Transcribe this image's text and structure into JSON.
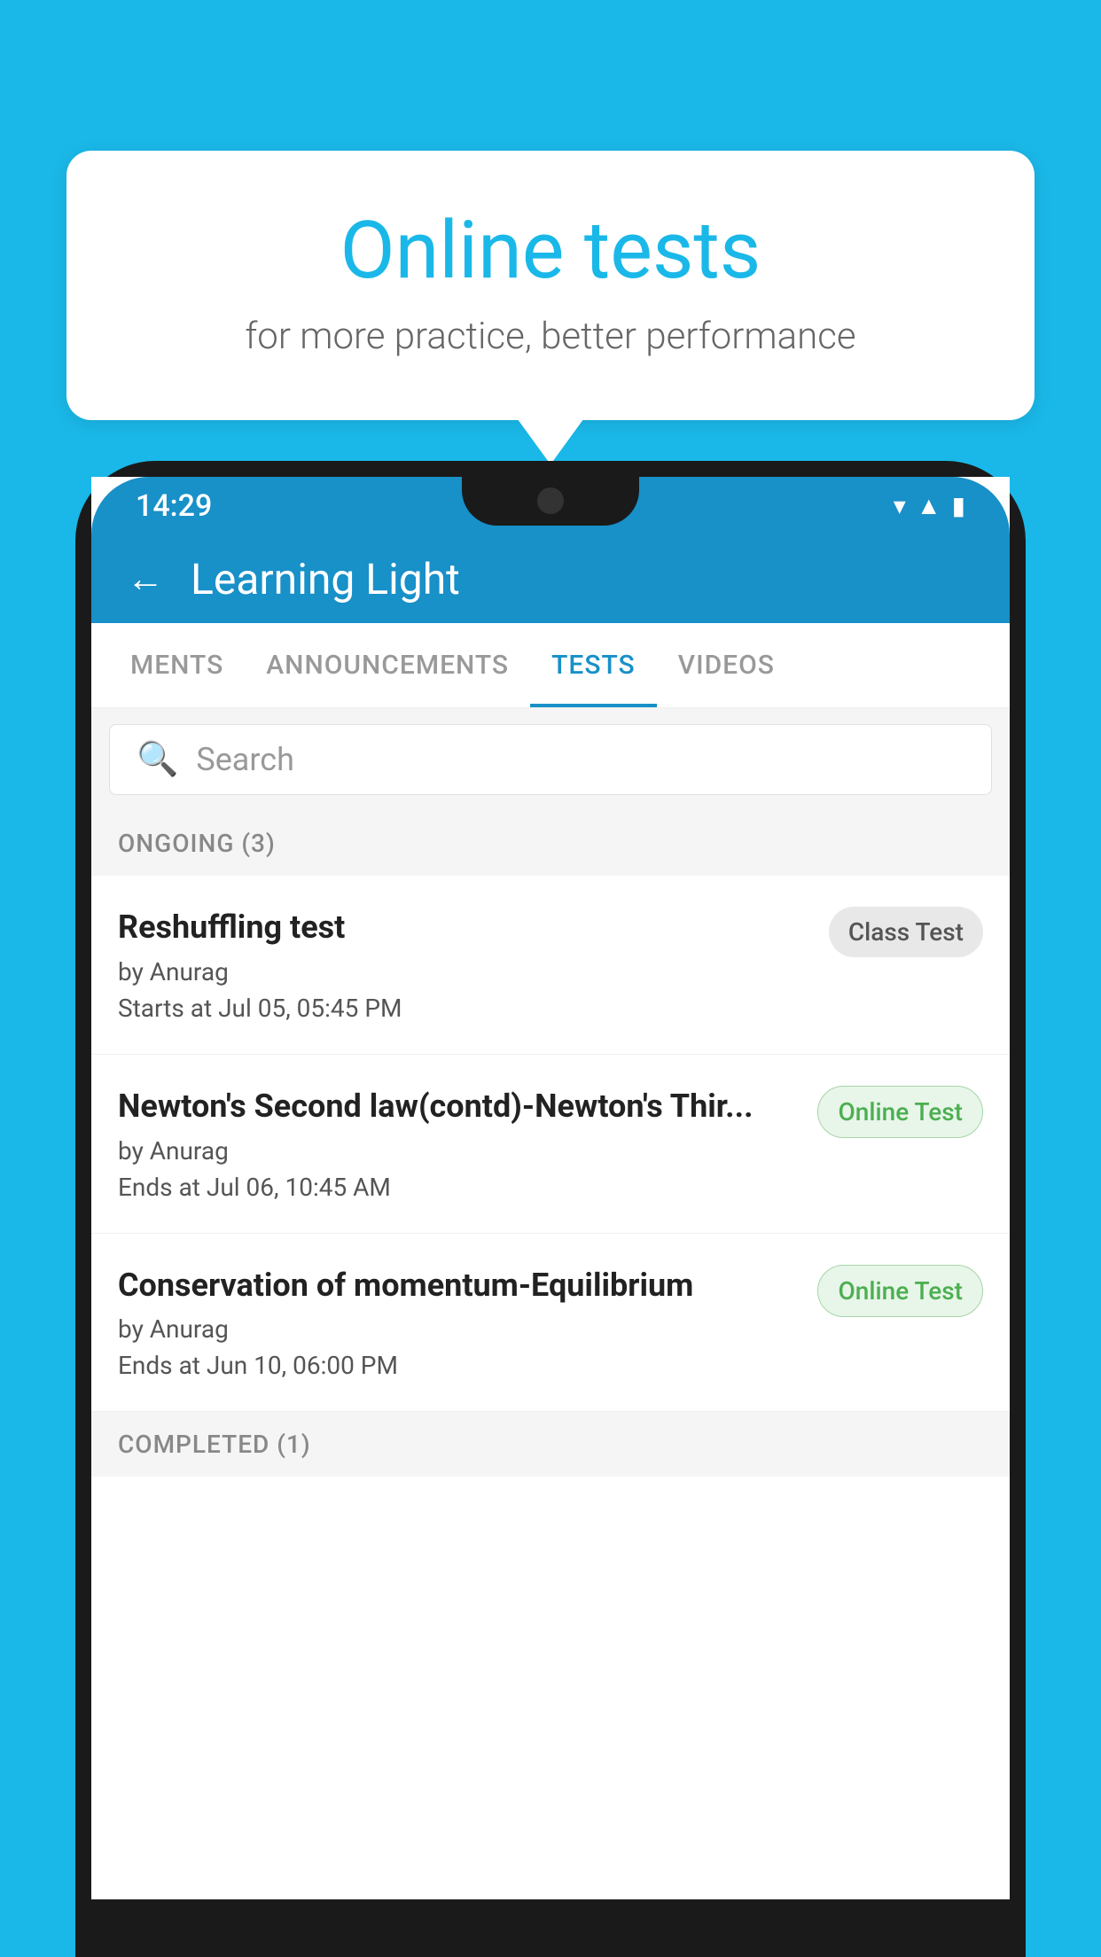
{
  "background": {
    "color": "#1ab8e8"
  },
  "speech_bubble": {
    "title": "Online tests",
    "subtitle": "for more practice, better performance"
  },
  "phone": {
    "status_bar": {
      "time": "14:29",
      "icons": [
        "wifi",
        "signal",
        "battery"
      ]
    },
    "header": {
      "back_label": "←",
      "title": "Learning Light"
    },
    "tabs": [
      {
        "label": "MENTS",
        "active": false
      },
      {
        "label": "ANNOUNCEMENTS",
        "active": false
      },
      {
        "label": "TESTS",
        "active": true
      },
      {
        "label": "VIDEOS",
        "active": false
      }
    ],
    "search": {
      "placeholder": "Search"
    },
    "ongoing_section": {
      "label": "ONGOING (3)"
    },
    "test_items": [
      {
        "name": "Reshuffling test",
        "author": "by Anurag",
        "time_label": "Starts at  Jul 05, 05:45 PM",
        "badge": "Class Test",
        "badge_type": "class"
      },
      {
        "name": "Newton's Second law(contd)-Newton's Thir...",
        "author": "by Anurag",
        "time_label": "Ends at  Jul 06, 10:45 AM",
        "badge": "Online Test",
        "badge_type": "online"
      },
      {
        "name": "Conservation of momentum-Equilibrium",
        "author": "by Anurag",
        "time_label": "Ends at  Jun 10, 06:00 PM",
        "badge": "Online Test",
        "badge_type": "online"
      }
    ],
    "completed_section": {
      "label": "COMPLETED (1)"
    }
  }
}
